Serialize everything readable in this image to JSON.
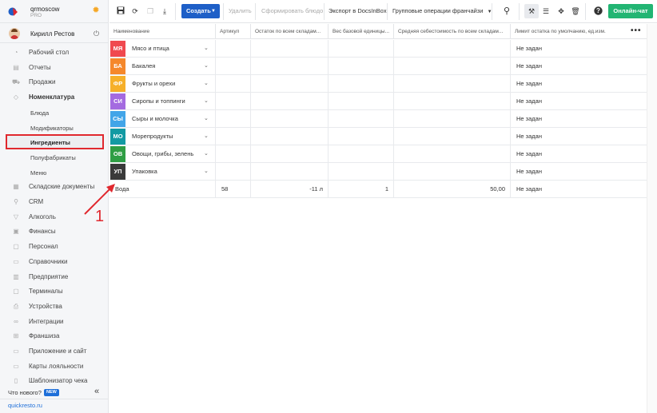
{
  "brand": {
    "name": "qrmoscow",
    "plan": "PRO"
  },
  "user": {
    "name": "Кирилл Рестов"
  },
  "sidebar": {
    "items": [
      {
        "label": "Рабочий стол",
        "icon": "dashboard-icon",
        "glyph": "◔"
      },
      {
        "label": "Отчеты",
        "icon": "reports-icon",
        "glyph": "▤"
      },
      {
        "label": "Продажи",
        "icon": "cart-icon",
        "glyph": "⛟"
      },
      {
        "label": "Номенклатура",
        "icon": "tag-icon",
        "glyph": "◇"
      }
    ],
    "sub_items": [
      {
        "label": "Блюда"
      },
      {
        "label": "Модификаторы"
      },
      {
        "label": "Ингредиенты"
      },
      {
        "label": "Полуфабрикаты"
      },
      {
        "label": "Меню"
      }
    ],
    "items_after": [
      {
        "label": "Складские документы",
        "icon": "warehouse-icon",
        "glyph": "▦"
      },
      {
        "label": "CRM",
        "icon": "crm-icon",
        "glyph": "⚲"
      },
      {
        "label": "Алкоголь",
        "icon": "glass-icon",
        "glyph": "▽"
      },
      {
        "label": "Финансы",
        "icon": "finance-icon",
        "glyph": "▣"
      },
      {
        "label": "Персонал",
        "icon": "staff-icon",
        "glyph": "▢"
      },
      {
        "label": "Справочники",
        "icon": "book-icon",
        "glyph": "▭"
      },
      {
        "label": "Предприятие",
        "icon": "building-icon",
        "glyph": "▥"
      },
      {
        "label": "Терминалы",
        "icon": "terminal-icon",
        "glyph": "▢"
      },
      {
        "label": "Устройства",
        "icon": "device-icon",
        "glyph": "⎙"
      },
      {
        "label": "Интеграции",
        "icon": "integration-icon",
        "glyph": "∞"
      },
      {
        "label": "Франшиза",
        "icon": "franchise-icon",
        "glyph": "⊞"
      },
      {
        "label": "Приложение и сайт",
        "icon": "app-icon",
        "glyph": "▭"
      },
      {
        "label": "Карты лояльности",
        "icon": "card-icon",
        "glyph": "▭"
      },
      {
        "label": "Шаблонизатор чека",
        "icon": "receipt-icon",
        "glyph": "▯"
      }
    ],
    "whats_new": "Что нового?",
    "new_badge": "NEW",
    "site": "quickresto.ru"
  },
  "toolbar": {
    "create": "Создать",
    "delete": "Удалить",
    "form_dish": "Сформировать блюдо",
    "export": "Экспорт в DocsInBox",
    "group_ops": "Групповые операции франчайзи",
    "chat": "Онлайн-чат"
  },
  "table": {
    "headers": [
      "Наименование",
      "Артикул",
      "Остаток по всем складам...",
      "Вес базовой единицы...",
      "Средняя себестоимость по всем складам...",
      "Лимит остатка по умолчанию, ед.изм."
    ],
    "groups": [
      {
        "tag": "МЯ",
        "color": "#f0494f",
        "name": "Мясо и птица",
        "limit": "Не задан"
      },
      {
        "tag": "БА",
        "color": "#f5882c",
        "name": "Бакалея",
        "limit": "Не задан"
      },
      {
        "tag": "ФР",
        "color": "#f6b02a",
        "name": "Фрукты и орехи",
        "limit": "Не задан"
      },
      {
        "tag": "СИ",
        "color": "#a46be0",
        "name": "Сиропы и топпинги",
        "limit": "Не задан"
      },
      {
        "tag": "СЫ",
        "color": "#42a5e8",
        "name": "Сыры и молочка",
        "limit": "Не задан"
      },
      {
        "tag": "МО",
        "color": "#139aa3",
        "name": "Морепродукты",
        "limit": "Не задан"
      },
      {
        "tag": "ОВ",
        "color": "#2f9e44",
        "name": "Овощи, грибы, зелень",
        "limit": "Не задан"
      },
      {
        "tag": "УП",
        "color": "#3a3a3a",
        "name": "Упаковка",
        "limit": "Не задан"
      }
    ],
    "item": {
      "name": "Вода",
      "article": "58",
      "stock": "-11 л",
      "weight": "1",
      "cost": "50,00",
      "limit": "Не задан"
    }
  },
  "annotation": {
    "number": "1",
    "color": "#e0282e"
  }
}
